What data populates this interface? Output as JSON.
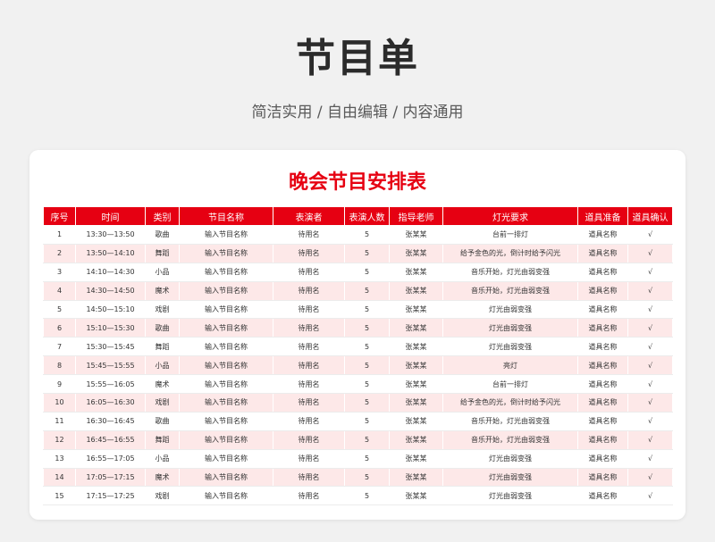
{
  "header": {
    "title": "节目单",
    "subtitle": "简洁实用 / 自由编辑 / 内容通用"
  },
  "table": {
    "title": "晚会节目安排表",
    "columns": [
      "序号",
      "时间",
      "类别",
      "节目名称",
      "表演者",
      "表演人数",
      "指导老师",
      "灯光要求",
      "道具准备",
      "道具确认"
    ],
    "rows": [
      [
        "1",
        "13:30—13:50",
        "歌曲",
        "输入节目名称",
        "待用名",
        "5",
        "张某某",
        "台前一排灯",
        "道具名称",
        "√"
      ],
      [
        "2",
        "13:50—14:10",
        "舞蹈",
        "输入节目名称",
        "待用名",
        "5",
        "张某某",
        "给予金色的光，倒计时给予闪光",
        "道具名称",
        "√"
      ],
      [
        "3",
        "14:10—14:30",
        "小品",
        "输入节目名称",
        "待用名",
        "5",
        "张某某",
        "音乐开始，灯光由弱变强",
        "道具名称",
        "√"
      ],
      [
        "4",
        "14:30—14:50",
        "魔术",
        "输入节目名称",
        "待用名",
        "5",
        "张某某",
        "音乐开始，灯光由弱变强",
        "道具名称",
        "√"
      ],
      [
        "5",
        "14:50—15:10",
        "戏剧",
        "输入节目名称",
        "待用名",
        "5",
        "张某某",
        "灯光由弱变强",
        "道具名称",
        "√"
      ],
      [
        "6",
        "15:10—15:30",
        "歌曲",
        "输入节目名称",
        "待用名",
        "5",
        "张某某",
        "灯光由弱变强",
        "道具名称",
        "√"
      ],
      [
        "7",
        "15:30—15:45",
        "舞蹈",
        "输入节目名称",
        "待用名",
        "5",
        "张某某",
        "灯光由弱变强",
        "道具名称",
        "√"
      ],
      [
        "8",
        "15:45—15:55",
        "小品",
        "输入节目名称",
        "待用名",
        "5",
        "张某某",
        "亮灯",
        "道具名称",
        "√"
      ],
      [
        "9",
        "15:55—16:05",
        "魔术",
        "输入节目名称",
        "待用名",
        "5",
        "张某某",
        "台前一排灯",
        "道具名称",
        "√"
      ],
      [
        "10",
        "16:05—16:30",
        "戏剧",
        "输入节目名称",
        "待用名",
        "5",
        "张某某",
        "给予金色的光，倒计时给予闪光",
        "道具名称",
        "√"
      ],
      [
        "11",
        "16:30—16:45",
        "歌曲",
        "输入节目名称",
        "待用名",
        "5",
        "张某某",
        "音乐开始，灯光由弱变强",
        "道具名称",
        "√"
      ],
      [
        "12",
        "16:45—16:55",
        "舞蹈",
        "输入节目名称",
        "待用名",
        "5",
        "张某某",
        "音乐开始，灯光由弱变强",
        "道具名称",
        "√"
      ],
      [
        "13",
        "16:55—17:05",
        "小品",
        "输入节目名称",
        "待用名",
        "5",
        "张某某",
        "灯光由弱变强",
        "道具名称",
        "√"
      ],
      [
        "14",
        "17:05—17:15",
        "魔术",
        "输入节目名称",
        "待用名",
        "5",
        "张某某",
        "灯光由弱变强",
        "道具名称",
        "√"
      ],
      [
        "15",
        "17:15—17:25",
        "戏剧",
        "输入节目名称",
        "待用名",
        "5",
        "张某某",
        "灯光由弱变强",
        "道具名称",
        "√"
      ]
    ]
  },
  "colors": {
    "accent": "#e60012",
    "stripe": "#fde8e8",
    "background": "#f1f1f1"
  }
}
